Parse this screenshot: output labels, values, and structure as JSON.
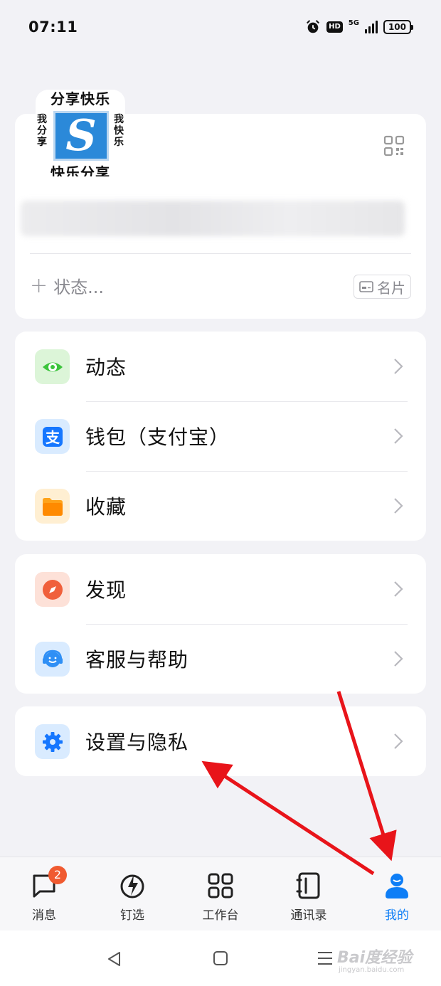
{
  "status_bar": {
    "time": "07:11",
    "hd": "HD",
    "network": "5G",
    "battery": "100"
  },
  "profile": {
    "avatar": {
      "top_text": "分享快乐",
      "left_text": "我分享",
      "right_text": "我快乐",
      "logo_letter": "S",
      "bottom_text": "快乐分享"
    },
    "status_placeholder": "状态...",
    "namecard_label": "名片"
  },
  "menu_groups": [
    {
      "items": [
        {
          "label": "动态",
          "icon": "eye-icon",
          "color": "#3cc43c"
        },
        {
          "label": "钱包（支付宝）",
          "icon": "alipay-icon",
          "color": "#1677ff"
        },
        {
          "label": "收藏",
          "icon": "folder-icon",
          "color": "#ffa31a"
        }
      ]
    },
    {
      "items": [
        {
          "label": "发现",
          "icon": "compass-icon",
          "color": "#f0603c"
        },
        {
          "label": "客服与帮助",
          "icon": "headset-icon",
          "color": "#2f8ff5"
        }
      ]
    },
    {
      "items": [
        {
          "label": "设置与隐私",
          "icon": "gear-icon",
          "color": "#1677ff"
        }
      ]
    }
  ],
  "tabs": [
    {
      "label": "消息",
      "icon": "message-icon",
      "badge": "2"
    },
    {
      "label": "钉选",
      "icon": "ding-icon"
    },
    {
      "label": "工作台",
      "icon": "workbench-icon"
    },
    {
      "label": "通讯录",
      "icon": "contacts-icon"
    },
    {
      "label": "我的",
      "icon": "me-icon",
      "active": true
    }
  ],
  "accent_color": "#0e7ef6",
  "watermark": {
    "main": "Bai度经验",
    "sub": "jingyan.baidu.com"
  }
}
